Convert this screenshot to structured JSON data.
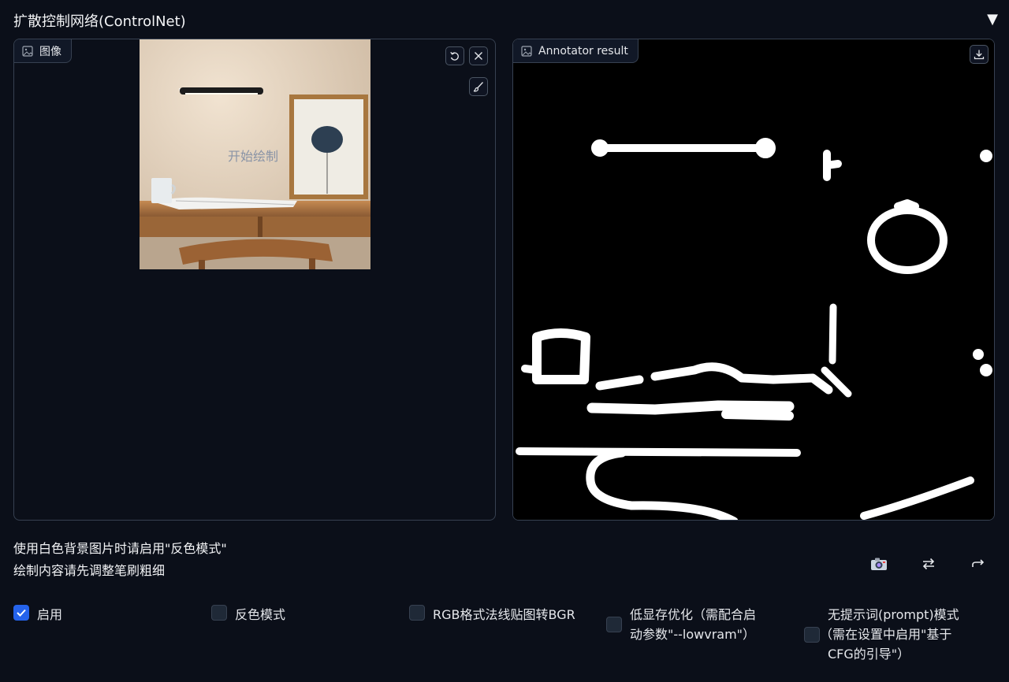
{
  "header": {
    "title": "扩散控制网络(ControlNet)",
    "collapse_icon": "▼"
  },
  "image_panel": {
    "label": "图像",
    "canvas_hint": "开始绘制",
    "buttons": [
      "undo-icon",
      "close-icon",
      "brush-icon"
    ]
  },
  "result_panel": {
    "label": "Annotator result",
    "buttons": [
      "download-icon"
    ]
  },
  "notes": {
    "line1": "使用白色背景图片时请启用\"反色模式\"",
    "line2": "绘制内容请先调整笔刷粗细"
  },
  "actions": [
    "camera-icon",
    "swap-icon",
    "send-icon"
  ],
  "options": {
    "enable": {
      "label": "启用",
      "checked": true
    },
    "invert": {
      "label": "反色模式",
      "checked": false
    },
    "rgb_bgr": {
      "label": "RGB格式法线贴图转BGR",
      "checked": false
    },
    "lowvram": {
      "label_line1": "低显存优化（需配合启",
      "label_line2": "动参数\"--lowvram\"）",
      "checked": false
    },
    "guess_mode": {
      "label_line1": "无提示词(prompt)模式",
      "label_line2": "（需在设置中启用\"基于",
      "label_line3": "CFG的引导\"）",
      "checked": false
    }
  },
  "colors": {
    "background": "#0b0f19",
    "border": "#374151",
    "accent": "#2563eb"
  }
}
